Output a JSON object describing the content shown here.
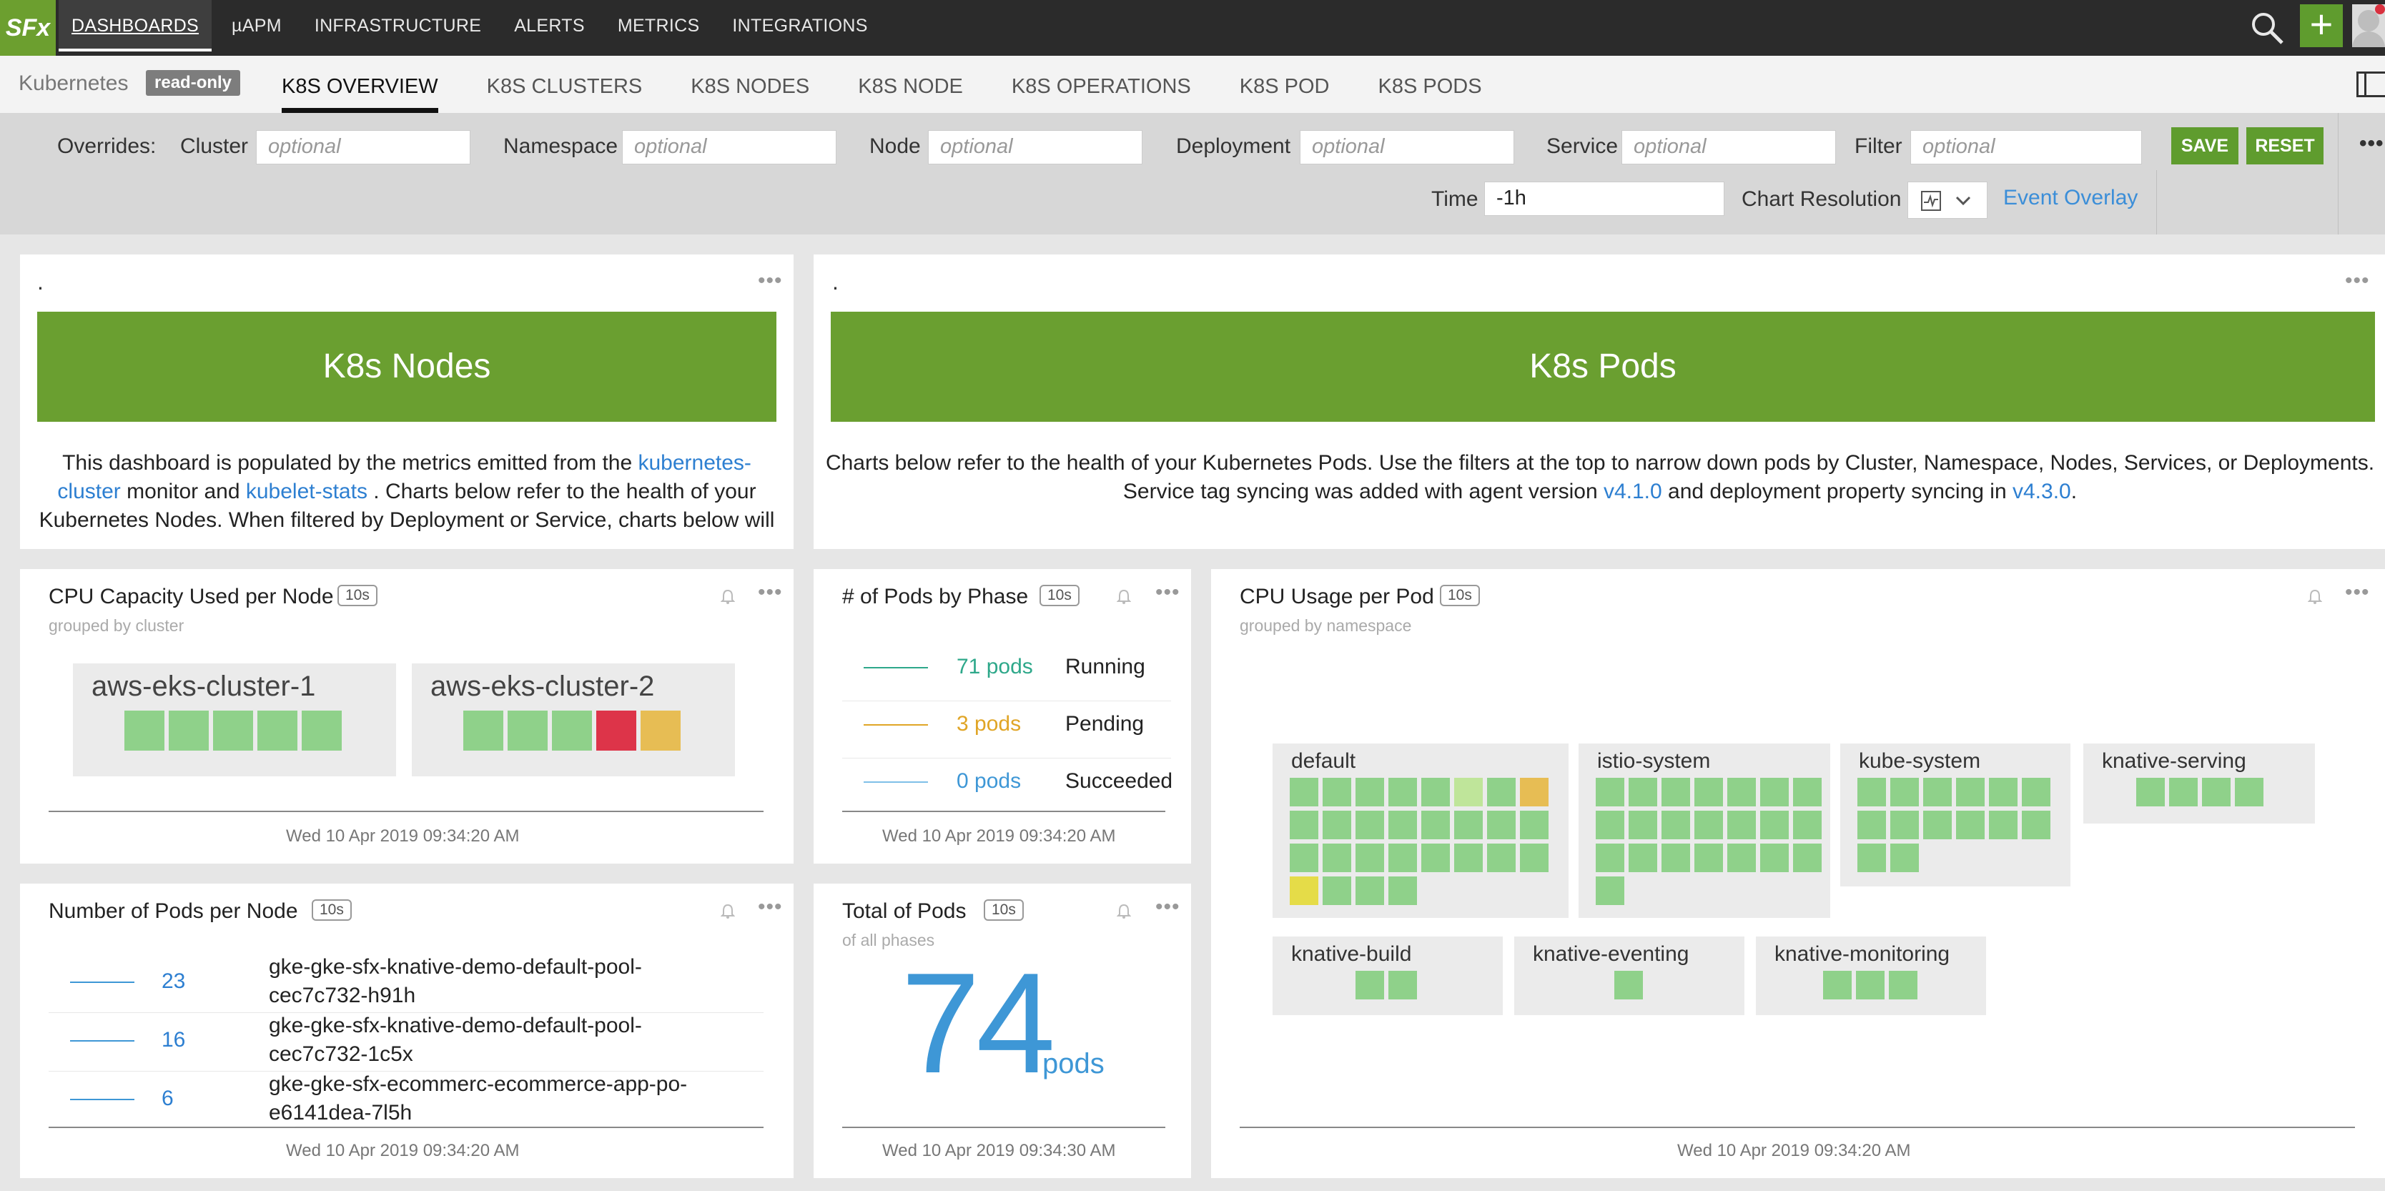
{
  "topbar": {
    "logo": "SFx",
    "nav": [
      "DASHBOARDS",
      "µAPM",
      "INFRASTRUCTURE",
      "ALERTS",
      "METRICS",
      "INTEGRATIONS"
    ],
    "plus": "+"
  },
  "tabbar": {
    "crumb": "Kubernetes",
    "badge": "read-only",
    "tabs": [
      "K8S OVERVIEW",
      "K8S CLUSTERS",
      "K8S NODES",
      "K8S NODE",
      "K8S OPERATIONS",
      "K8S POD",
      "K8S PODS"
    ]
  },
  "filters": {
    "overrides_label": "Overrides:",
    "cluster_label": "Cluster",
    "namespace_label": "Namespace",
    "node_label": "Node",
    "deployment_label": "Deployment",
    "service_label": "Service",
    "filter_label": "Filter",
    "placeholder": "optional",
    "save": "SAVE",
    "reset": "RESET",
    "time_label": "Time",
    "time_value": "-1h",
    "resolution_label": "Chart Resolution",
    "event_overlay": "Event Overlay"
  },
  "nodes_text": {
    "dot": ".",
    "banner": "K8s Nodes",
    "line1_a": "This dashboard is populated by the metrics emitted from the ",
    "line1_link": "kubernetes-",
    "line2_link": "cluster",
    "line2_b": " monitor and ",
    "line2_link2": "kubelet-stats",
    "line2_c": " . Charts below refer to the health of your",
    "line3": "Kubernetes Nodes. When filtered by Deployment or Service, charts below will"
  },
  "pods_text": {
    "dot": ".",
    "banner": "K8s Pods",
    "line1": "Charts below refer to the health of your Kubernetes Pods. Use the filters at the top to narrow down pods by Cluster, Namespace, Nodes, Services, or Deployments.",
    "line2_a": "Service tag syncing was added with agent version ",
    "line2_link": "v4.1.0",
    "line2_b": " and deployment property syncing in ",
    "line2_link2": "v4.3.0",
    "line2_c": "."
  },
  "cpu_capacity": {
    "title": "CPU Capacity Used per Node",
    "badge": "10s",
    "subtitle": "grouped by cluster",
    "clusters": [
      {
        "name": "aws-eks-cluster-1",
        "cells": [
          "#8fd18a",
          "#8fd18a",
          "#8fd18a",
          "#8fd18a",
          "#8fd18a"
        ]
      },
      {
        "name": "aws-eks-cluster-2",
        "cells": [
          "#8fd18a",
          "#8fd18a",
          "#8fd18a",
          "#dd3449",
          "#e7bd54"
        ]
      }
    ],
    "timestamp": "Wed 10 Apr 2019 09:34:20 AM"
  },
  "pods_by_phase": {
    "title": "# of Pods by Phase",
    "badge": "10s",
    "rows": [
      {
        "value": "71 pods",
        "name": "Running",
        "color": "#2ea88a"
      },
      {
        "value": "3 pods",
        "name": "Pending",
        "color": "#e0a526"
      },
      {
        "value": "0 pods",
        "name": "Succeeded",
        "color": "#3e97d6"
      }
    ],
    "timestamp": "Wed 10 Apr 2019 09:34:20 AM"
  },
  "cpu_usage_pod": {
    "title": "CPU Usage per Pod",
    "badge": "10s",
    "subtitle": "grouped by namespace",
    "namespaces": [
      "default",
      "istio-system",
      "kube-system",
      "knative-serving",
      "knative-build",
      "knative-eventing",
      "knative-monitoring"
    ],
    "timestamp": "Wed 10 Apr 2019 09:34:20 AM"
  },
  "pods_per_node": {
    "title": "Number of Pods per Node",
    "badge": "10s",
    "rows": [
      {
        "value": "23",
        "name1": "gke-gke-sfx-knative-demo-default-pool-",
        "name2": "cec7c732-h91h"
      },
      {
        "value": "16",
        "name1": "gke-gke-sfx-knative-demo-default-pool-",
        "name2": "cec7c732-1c5x"
      },
      {
        "value": "6",
        "name1": "gke-gke-sfx-ecommerc-ecommerce-app-po-",
        "name2": "e6141dea-7l5h"
      }
    ],
    "timestamp": "Wed 10 Apr 2019 09:34:20 AM"
  },
  "total_pods": {
    "title": "Total of Pods",
    "badge": "10s",
    "subtitle": "of all phases",
    "value": "74",
    "unit": "pods",
    "timestamp": "Wed 10 Apr 2019 09:34:30 AM"
  },
  "colors": {
    "accent_green": "#6a9f30",
    "link_blue": "#2d7fd1",
    "cell_green": "#8fd18a",
    "cell_light": "#bfe59a",
    "cell_yellow": "#e5dc48",
    "cell_orange": "#e7bd54",
    "cell_red": "#dd3449"
  }
}
